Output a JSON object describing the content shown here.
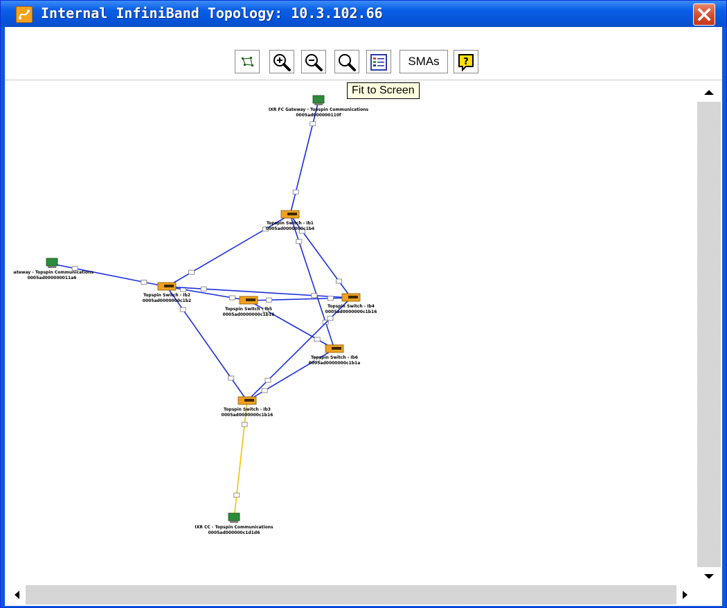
{
  "window": {
    "title": "Internal InfiniBand Topology: 10.3.102.66",
    "title_icon": "topology-app-icon",
    "close_icon": "close-icon",
    "accent_color": "#0555dc",
    "close_color": "#d04a2a"
  },
  "toolbar": {
    "buttons": [
      {
        "icon": "layout-graph-icon"
      },
      {
        "icon": "zoom-in-icon"
      },
      {
        "icon": "zoom-out-icon"
      },
      {
        "icon": "fit-to-screen-icon"
      },
      {
        "icon": "legend-list-icon"
      },
      {
        "label": "SMAs"
      },
      {
        "icon": "help-icon"
      }
    ],
    "tooltip": "Fit to Screen"
  },
  "topology": {
    "link_color": "#1a2ee0",
    "special_link_color": "#f2c200",
    "switch_color": "#f0a020",
    "gateway_color": "#2e8b3a",
    "nodes": [
      {
        "id": "gw-top",
        "kind": "gateway",
        "name": "IXR FC Gateway - Topspin Communications",
        "guid": "0005ad000000110f"
      },
      {
        "id": "sw-1",
        "kind": "switch",
        "name": "Topspin Switch - Ib1",
        "guid": "0005ad0000000c1b4"
      },
      {
        "id": "gw-left",
        "kind": "gateway",
        "name": "Gateway - Topspin Communications",
        "guid": "0005ad000000011a6"
      },
      {
        "id": "sw-2",
        "kind": "switch",
        "name": "Topspin Switch - Ib2",
        "guid": "0005ad0000000c1b2"
      },
      {
        "id": "sw-5",
        "kind": "switch",
        "name": "Topspin Switch - Ib5",
        "guid": "0005ad0000000c1b16"
      },
      {
        "id": "sw-4",
        "kind": "switch",
        "name": "Topspin Switch - Ib4",
        "guid": "0005ad0000000c1b16"
      },
      {
        "id": "sw-6",
        "kind": "switch",
        "name": "Topspin Switch - Ib6",
        "guid": "0005ad0000000c1b1a"
      },
      {
        "id": "sw-3",
        "kind": "switch",
        "name": "Topspin Switch - Ib3",
        "guid": "0005ad0000000c1b16"
      },
      {
        "id": "ca-bottom",
        "kind": "gateway",
        "name": "IXR CC - Topspin Communications",
        "guid": "0005ad000000c1d1d6"
      }
    ],
    "links": [
      {
        "from": "gw-top",
        "to": "sw-1",
        "kind": "normal"
      },
      {
        "from": "sw-1",
        "to": "sw-2",
        "kind": "normal"
      },
      {
        "from": "sw-1",
        "to": "sw-4",
        "kind": "normal"
      },
      {
        "from": "sw-1",
        "to": "sw-6",
        "kind": "normal"
      },
      {
        "from": "gw-left",
        "to": "sw-2",
        "kind": "normal"
      },
      {
        "from": "sw-2",
        "to": "sw-5",
        "kind": "normal"
      },
      {
        "from": "sw-2",
        "to": "sw-4",
        "kind": "normal"
      },
      {
        "from": "sw-2",
        "to": "sw-3",
        "kind": "normal"
      },
      {
        "from": "sw-5",
        "to": "sw-4",
        "kind": "normal"
      },
      {
        "from": "sw-5",
        "to": "sw-6",
        "kind": "normal"
      },
      {
        "from": "sw-4",
        "to": "sw-3",
        "kind": "normal"
      },
      {
        "from": "sw-6",
        "to": "sw-3",
        "kind": "normal"
      },
      {
        "from": "sw-3",
        "to": "ca-bottom",
        "kind": "special"
      }
    ]
  },
  "scrollbars": {
    "up_icon": "scroll-up-arrow-icon",
    "down_icon": "scroll-down-arrow-icon",
    "left_icon": "scroll-left-arrow-icon",
    "right_icon": "scroll-right-arrow-icon"
  }
}
